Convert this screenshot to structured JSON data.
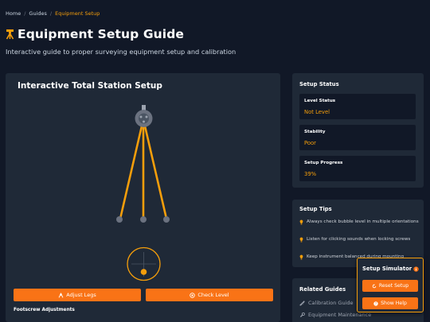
{
  "breadcrumb": {
    "items": [
      "Home",
      "Guides",
      "Equipment Setup"
    ],
    "separator": "/"
  },
  "header": {
    "icon": "tripod-icon",
    "title": "Equipment Setup Guide",
    "subtitle": "Interactive guide to proper surveying equipment setup and calibration"
  },
  "main": {
    "title": "Interactive Total Station Setup",
    "buttons": {
      "adjust_legs": "Adjust Legs",
      "check_level": "Check Level"
    },
    "footscrew_label": "Footscrew Adjustments"
  },
  "status": {
    "title": "Setup Status",
    "cards": [
      {
        "label": "Level Status",
        "value": "Not Level"
      },
      {
        "label": "Stability",
        "value": "Poor"
      },
      {
        "label": "Setup Progress",
        "value": "39%"
      }
    ]
  },
  "tips": {
    "title": "Setup Tips",
    "items": [
      "Always check bubble level in multiple orientations",
      "Listen for clicking sounds when locking screws",
      "Keep instrument balanced during mounting"
    ]
  },
  "related": {
    "title": "Related Guides",
    "items": [
      {
        "label": "Calibration Guide",
        "icon": "ruler-icon"
      },
      {
        "label": "Equipment Maintenance",
        "icon": "wrench-icon"
      }
    ]
  },
  "simulator": {
    "title": "Setup Simulator",
    "reset_label": "Reset Setup",
    "help_label": "Show Help"
  },
  "colors": {
    "accent": "#f97316",
    "amber": "#f59e0b",
    "background": "#111827",
    "panel": "#1f2937"
  }
}
